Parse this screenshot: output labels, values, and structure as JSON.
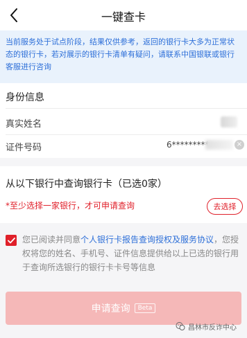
{
  "header": {
    "title": "一键查卡"
  },
  "notice": {
    "text": "当前服务处于试点阶段，结果仅供参考，返回的银行卡大多为正常状态的银行卡，若对展示的银行卡清单有疑问，请联系中国银联或银行客服进行咨询"
  },
  "identity": {
    "section_title": "身份信息",
    "name_label": "真实姓名",
    "id_label": "证件号码",
    "id_value": "6*********"
  },
  "bank_query": {
    "section_title": "从以下银行中查询银行卡（已选0家）",
    "warning": "*至少选择一家银行，才可申请查询",
    "choose_button": "去选择"
  },
  "agreement": {
    "text_before": "您已阅读并同意",
    "link": "个人银行卡报告查询授权及服务协议",
    "text_after": "，您授权将您的姓名、手机号、证件信息提供给以上已选的银行用于查询所选银行的银行卡卡号等信息",
    "checked": true
  },
  "submit": {
    "label": "申请查询",
    "badge": "Beta"
  },
  "watermark": {
    "text": "昌林市反诈中心"
  },
  "colors": {
    "accent_red": "#e0202a",
    "link_blue": "#2d6fd8",
    "notice_bg": "#e9f2fc",
    "submit_disabled": "#f5b8b8"
  },
  "icons": {
    "back": "chevron-left-icon",
    "checkbox": "check-icon",
    "clear": "clear-icon",
    "watermark": "wechat-icon"
  }
}
